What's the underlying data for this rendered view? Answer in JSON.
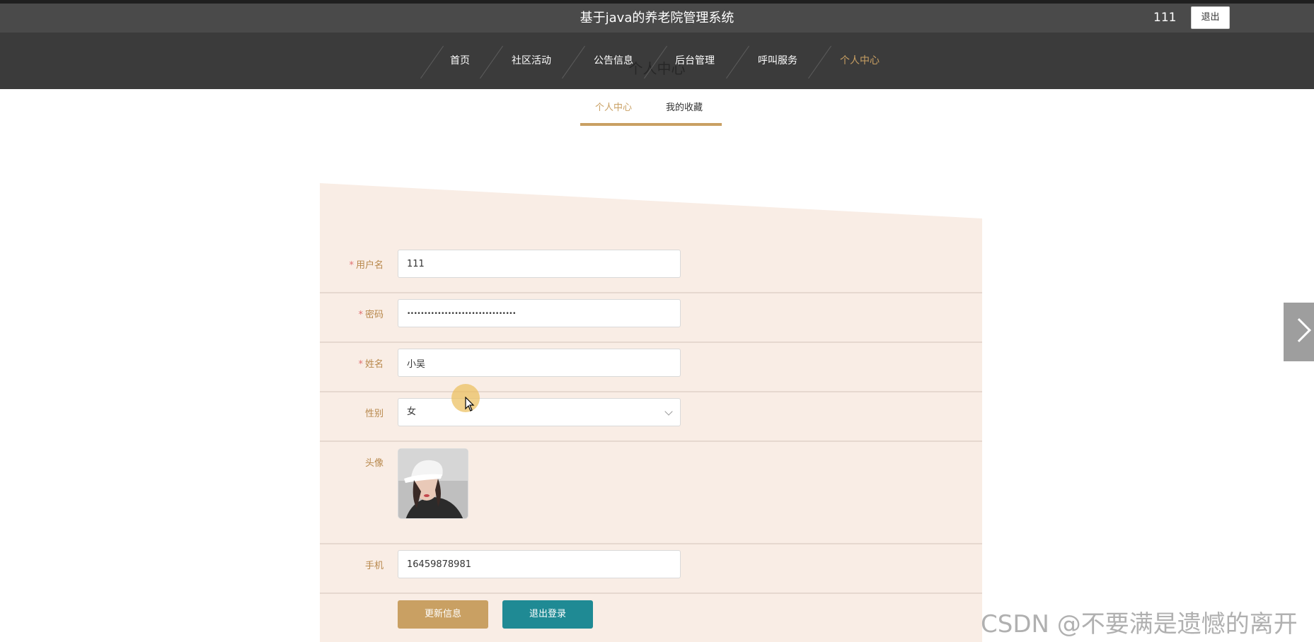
{
  "header": {
    "site_title": "基于java的养老院管理系统",
    "username": "111",
    "logout_label": "退出"
  },
  "nav": {
    "items": [
      {
        "label": "首页",
        "active": false
      },
      {
        "label": "社区活动",
        "active": false
      },
      {
        "label": "公告信息",
        "active": false
      },
      {
        "label": "后台管理",
        "active": false
      },
      {
        "label": "呼叫服务",
        "active": false
      },
      {
        "label": "个人中心",
        "active": true
      }
    ],
    "ghost_title": "个人中心"
  },
  "tabs": [
    {
      "label": "个人中心",
      "active": true
    },
    {
      "label": "我的收藏",
      "active": false
    }
  ],
  "form": {
    "username": {
      "label": "用户名",
      "required": "*",
      "value": "111"
    },
    "password": {
      "label": "密码",
      "required": "*",
      "value": "••••••••••••••••••••••••••••••••"
    },
    "name": {
      "label": "姓名",
      "required": "*",
      "value": "小吴"
    },
    "gender": {
      "label": "性别",
      "value": "女"
    },
    "avatar": {
      "label": "头像"
    },
    "phone": {
      "label": "手机",
      "value": "16459878981"
    }
  },
  "buttons": {
    "update": "更新信息",
    "logout": "退出登录"
  },
  "watermark": "CSDN @不要满是遗憾的离开",
  "colors": {
    "accent": "#c9a063",
    "teal": "#1f8a94",
    "nav_bg": "#3b3b3b",
    "form_bg": "#f9ede5"
  }
}
